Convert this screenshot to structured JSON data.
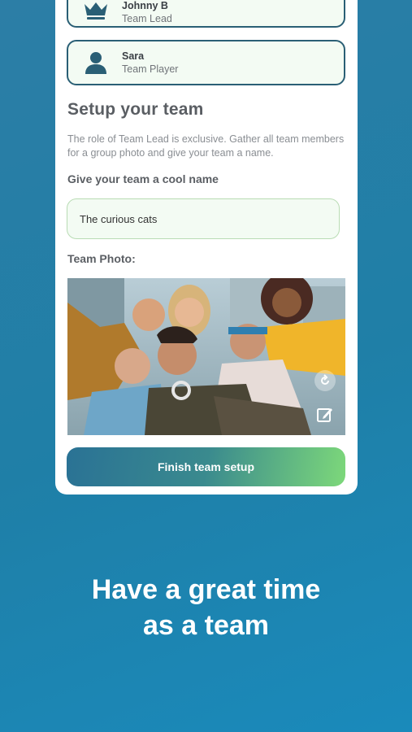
{
  "members": [
    {
      "name": "Johnny B",
      "role": "Team Lead",
      "icon": "crown-icon"
    },
    {
      "name": "Sara",
      "role": "Team Player",
      "icon": "person-icon"
    }
  ],
  "setup": {
    "title": "Setup your team",
    "description": "The role of Team Lead is exclusive. Gather all team members for a group photo and give your team a name.",
    "name_label": "Give your team a cool name",
    "name_value": "The curious cats",
    "photo_label": "Team Photo:",
    "photo_icons": [
      "rotate-icon",
      "edit-icon"
    ],
    "finish_label": "Finish team setup"
  },
  "tagline": {
    "line1": "Have a great time",
    "line2": "as a team"
  },
  "colors": {
    "background": "#1f7fa7",
    "accent_dark": "#2a5f75",
    "field_bg": "#f3fbf3",
    "button_gradient_start": "#2a7295",
    "button_gradient_end": "#7dd87a"
  }
}
